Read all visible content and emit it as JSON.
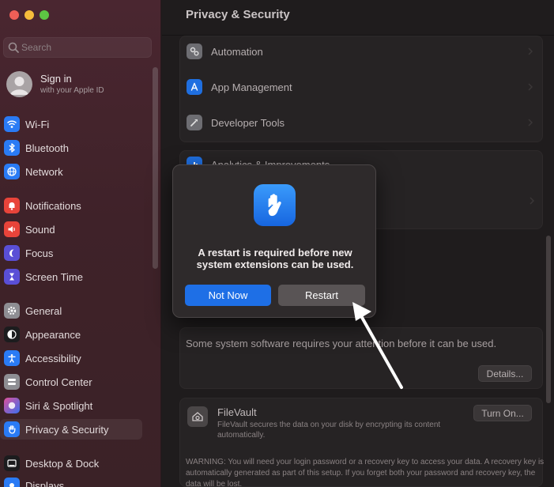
{
  "sidebar": {
    "search_placeholder": "Search",
    "account": {
      "name": "Sign in",
      "subtitle": "with your Apple ID"
    },
    "items": [
      {
        "label": "Wi-Fi",
        "icon": "wifi-icon",
        "color": "#2a7bf5"
      },
      {
        "label": "Bluetooth",
        "icon": "bluetooth-icon",
        "color": "#2a7bf5"
      },
      {
        "label": "Network",
        "icon": "globe-icon",
        "color": "#2a7bf5"
      },
      {
        "label": "Notifications",
        "icon": "bell-icon",
        "color": "#e8443a"
      },
      {
        "label": "Sound",
        "icon": "speaker-icon",
        "color": "#e8443a"
      },
      {
        "label": "Focus",
        "icon": "moon-icon",
        "color": "#5a4fd6"
      },
      {
        "label": "Screen Time",
        "icon": "hourglass-icon",
        "color": "#5a4fd6"
      },
      {
        "label": "General",
        "icon": "gear-icon",
        "color": "#8e8e93"
      },
      {
        "label": "Appearance",
        "icon": "appearance-icon",
        "color": "#1c1c1e"
      },
      {
        "label": "Accessibility",
        "icon": "accessibility-icon",
        "color": "#2a7bf5"
      },
      {
        "label": "Control Center",
        "icon": "control-center-icon",
        "color": "#8e8e93"
      },
      {
        "label": "Siri & Spotlight",
        "icon": "siri-icon",
        "color": "#7a3fd0"
      },
      {
        "label": "Privacy & Security",
        "icon": "hand-icon",
        "color": "#2a7bf5"
      },
      {
        "label": "Desktop & Dock",
        "icon": "dock-icon",
        "color": "#1c1c1e"
      },
      {
        "label": "Displays",
        "icon": "display-icon",
        "color": "#2a7bf5"
      }
    ]
  },
  "main": {
    "title": "Privacy & Security",
    "rows": [
      {
        "label": "Automation",
        "icon": "gears-icon",
        "color": "#8e8e93"
      },
      {
        "label": "App Management",
        "icon": "app-store-icon",
        "color": "#2a7bf5"
      },
      {
        "label": "Developer Tools",
        "icon": "hammer-icon",
        "color": "#8e8e93"
      },
      {
        "label": "Analytics & Improvements",
        "icon": "chart-icon",
        "color": "#2a7bf5"
      }
    ],
    "attention_text": "Some system software requires your attention before it can be used.",
    "details_button": "Details...",
    "filevault": {
      "title": "FileVault",
      "description": "FileVault secures the data on your disk by encrypting its content automatically.",
      "button": "Turn On..."
    },
    "warning": "WARNING: You will need your login password or a recovery key to access your data. A recovery key is automatically generated as part of this setup. If you forget both your password and recovery key, the data will be lost."
  },
  "dialog": {
    "message": "A restart is required before new system extensions can be used.",
    "not_now": "Not Now",
    "restart": "Restart",
    "icon": "hand-raised-icon"
  }
}
